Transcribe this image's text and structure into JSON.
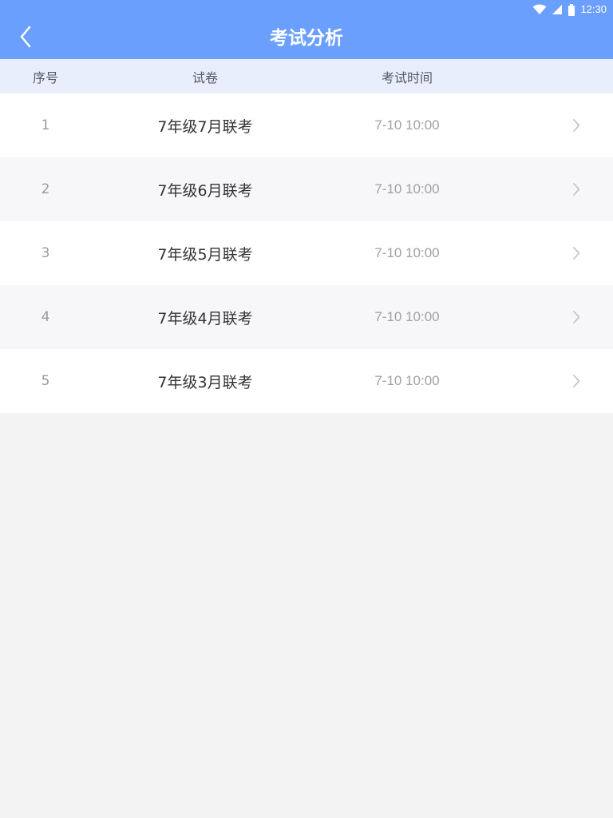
{
  "status_bar": {
    "time": "12:30",
    "icons": [
      "wifi-icon",
      "cellular-signal-icon",
      "battery-icon"
    ]
  },
  "header": {
    "title": "考试分析",
    "back_icon": "chevron-left-icon",
    "background_color": "#6b9ffe"
  },
  "table": {
    "columns": {
      "index": "序号",
      "paper": "试卷",
      "time": "考试时间"
    },
    "header_background": "#e8eefc",
    "rows": [
      {
        "index": "1",
        "paper": "7年级7月联考",
        "time": "7-10  10:00"
      },
      {
        "index": "2",
        "paper": "7年级6月联考",
        "time": "7-10  10:00"
      },
      {
        "index": "3",
        "paper": "7年级5月联考",
        "time": "7-10  10:00"
      },
      {
        "index": "4",
        "paper": "7年级4月联考",
        "time": "7-10  10:00"
      },
      {
        "index": "5",
        "paper": "7年级3月联考",
        "time": "7-10  10:00"
      }
    ],
    "row_arrow_icon": "chevron-right-icon"
  }
}
